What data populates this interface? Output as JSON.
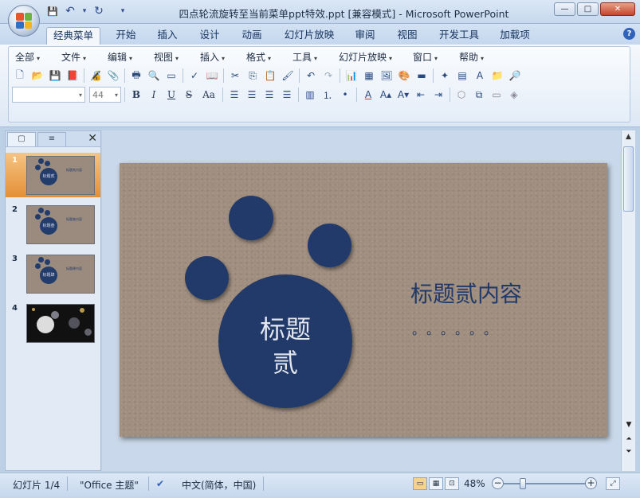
{
  "window": {
    "title": "四点轮流旋转至当前菜单ppt特效.ppt [兼容模式] - Microsoft PowerPoint",
    "controls": {
      "minimize": "—",
      "maximize": "□",
      "close": "✕"
    }
  },
  "qat": {
    "save": "💾",
    "undo": "↶",
    "undo_more": "▾",
    "redo": "↻",
    "customize": "▾"
  },
  "ribbon_tabs": [
    "经典菜单",
    "开始",
    "插入",
    "设计",
    "动画",
    "幻灯片放映",
    "审阅",
    "视图",
    "开发工具",
    "加载项"
  ],
  "active_tab": "经典菜单",
  "help": "?",
  "classic_menu": [
    "全部",
    "文件",
    "编辑",
    "视图",
    "插入",
    "格式",
    "工具",
    "幻灯片放映",
    "窗口",
    "帮助"
  ],
  "font": {
    "name": "",
    "size": "44"
  },
  "format_buttons": {
    "bold": "B",
    "italic": "I",
    "underline": "U",
    "strike": "S",
    "case": "Aa"
  },
  "leftpane": {
    "tab_slides": "▢",
    "tab_outline": "≡",
    "close": "✕",
    "slides": [
      {
        "num": "1",
        "selected": true,
        "thumb_title": "标题贰内容",
        "thumb_circle": "标题贰"
      },
      {
        "num": "2",
        "selected": false,
        "thumb_title": "标题叁内容",
        "thumb_circle": "标题叁"
      },
      {
        "num": "3",
        "selected": false,
        "thumb_title": "标题肆内容",
        "thumb_circle": "标题肆"
      },
      {
        "num": "4",
        "selected": false,
        "thumb_title": "",
        "thumb_circle": ""
      }
    ]
  },
  "slide": {
    "circle_line1": "标题",
    "circle_line2": "贰",
    "content_title": "标题贰内容",
    "dots": "。。。。。。",
    "circle_color": "#213a69",
    "background_color": "#a08e7f"
  },
  "status": {
    "slide_counter": "幻灯片 1/4",
    "theme": "\"Office 主题\"",
    "language": "中文(简体，中国)",
    "zoom": "48%"
  }
}
